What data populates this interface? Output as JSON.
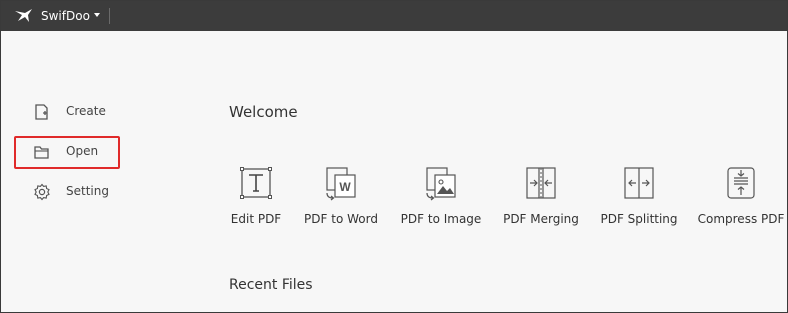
{
  "app": {
    "name": "SwifDoo",
    "logo_icon": "swift-bird-icon",
    "menu_icon": "caret-down-icon"
  },
  "sidebar": {
    "items": [
      {
        "label": "Create",
        "icon": "create-file-icon"
      },
      {
        "label": "Open",
        "icon": "folder-icon",
        "highlighted": true
      },
      {
        "label": "Setting",
        "icon": "gear-icon"
      }
    ]
  },
  "main": {
    "welcome": "Welcome",
    "tools": [
      {
        "label": "Edit PDF",
        "icon": "text-edit-icon"
      },
      {
        "label": "PDF to Word",
        "icon": "word-convert-icon"
      },
      {
        "label": "PDF to Image",
        "icon": "image-convert-icon"
      },
      {
        "label": "PDF Merging",
        "icon": "merge-icon"
      },
      {
        "label": "PDF Splitting",
        "icon": "split-icon"
      },
      {
        "label": "Compress PDF",
        "icon": "compress-icon"
      }
    ],
    "recent_files": "Recent Files"
  },
  "colors": {
    "titlebar": "#3c3c3c",
    "highlight": "#e02a2a",
    "background": "#f7f7f7"
  }
}
